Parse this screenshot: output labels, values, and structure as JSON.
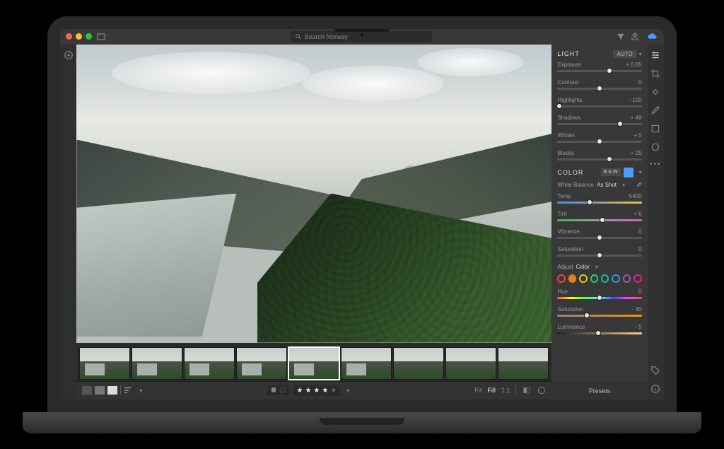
{
  "search": {
    "placeholder": "Search Norway"
  },
  "light": {
    "title": "LIGHT",
    "auto": "AUTO",
    "sliders": [
      {
        "label": "Exposure",
        "value": "+ 0.65",
        "pos": 62
      },
      {
        "label": "Contrast",
        "value": "0",
        "pos": 50
      },
      {
        "label": "Highlights",
        "value": "- 100",
        "pos": 2
      },
      {
        "label": "Shadows",
        "value": "+ 49",
        "pos": 74
      },
      {
        "label": "Whites",
        "value": "+ 0",
        "pos": 50
      },
      {
        "label": "Blacks",
        "value": "+ 25",
        "pos": 62
      }
    ]
  },
  "color": {
    "title": "COLOR",
    "bw": "B & W",
    "wb_label": "White Balance",
    "wb_value": "As Shot",
    "temp": {
      "label": "Temp",
      "value": "5400",
      "pos": 38
    },
    "tint": {
      "label": "Tint",
      "value": "+ 6",
      "pos": 53
    },
    "vibrance": {
      "label": "Vibrance",
      "value": "0",
      "pos": 50
    },
    "saturation": {
      "label": "Saturation",
      "value": "0",
      "pos": 50
    }
  },
  "mixer": {
    "adjust_label": "Adjust",
    "adjust_value": "Color",
    "swatches": [
      "#e74c3c",
      "#e67e22",
      "#f1c40f",
      "#2ecc71",
      "#1abc9c",
      "#3498db",
      "#9b59b6",
      "#e91e8c"
    ],
    "selected_index": 1,
    "hue": {
      "label": "Hue",
      "value": "0",
      "pos": 50
    },
    "saturation": {
      "label": "Saturation",
      "value": "- 30",
      "pos": 35
    },
    "luminance": {
      "label": "Luminance",
      "value": "- 5",
      "pos": 48
    }
  },
  "bottombar": {
    "stars": 4,
    "fit": "Fit",
    "fill": "Fill",
    "ratio": "1:1"
  },
  "presets": "Presets"
}
